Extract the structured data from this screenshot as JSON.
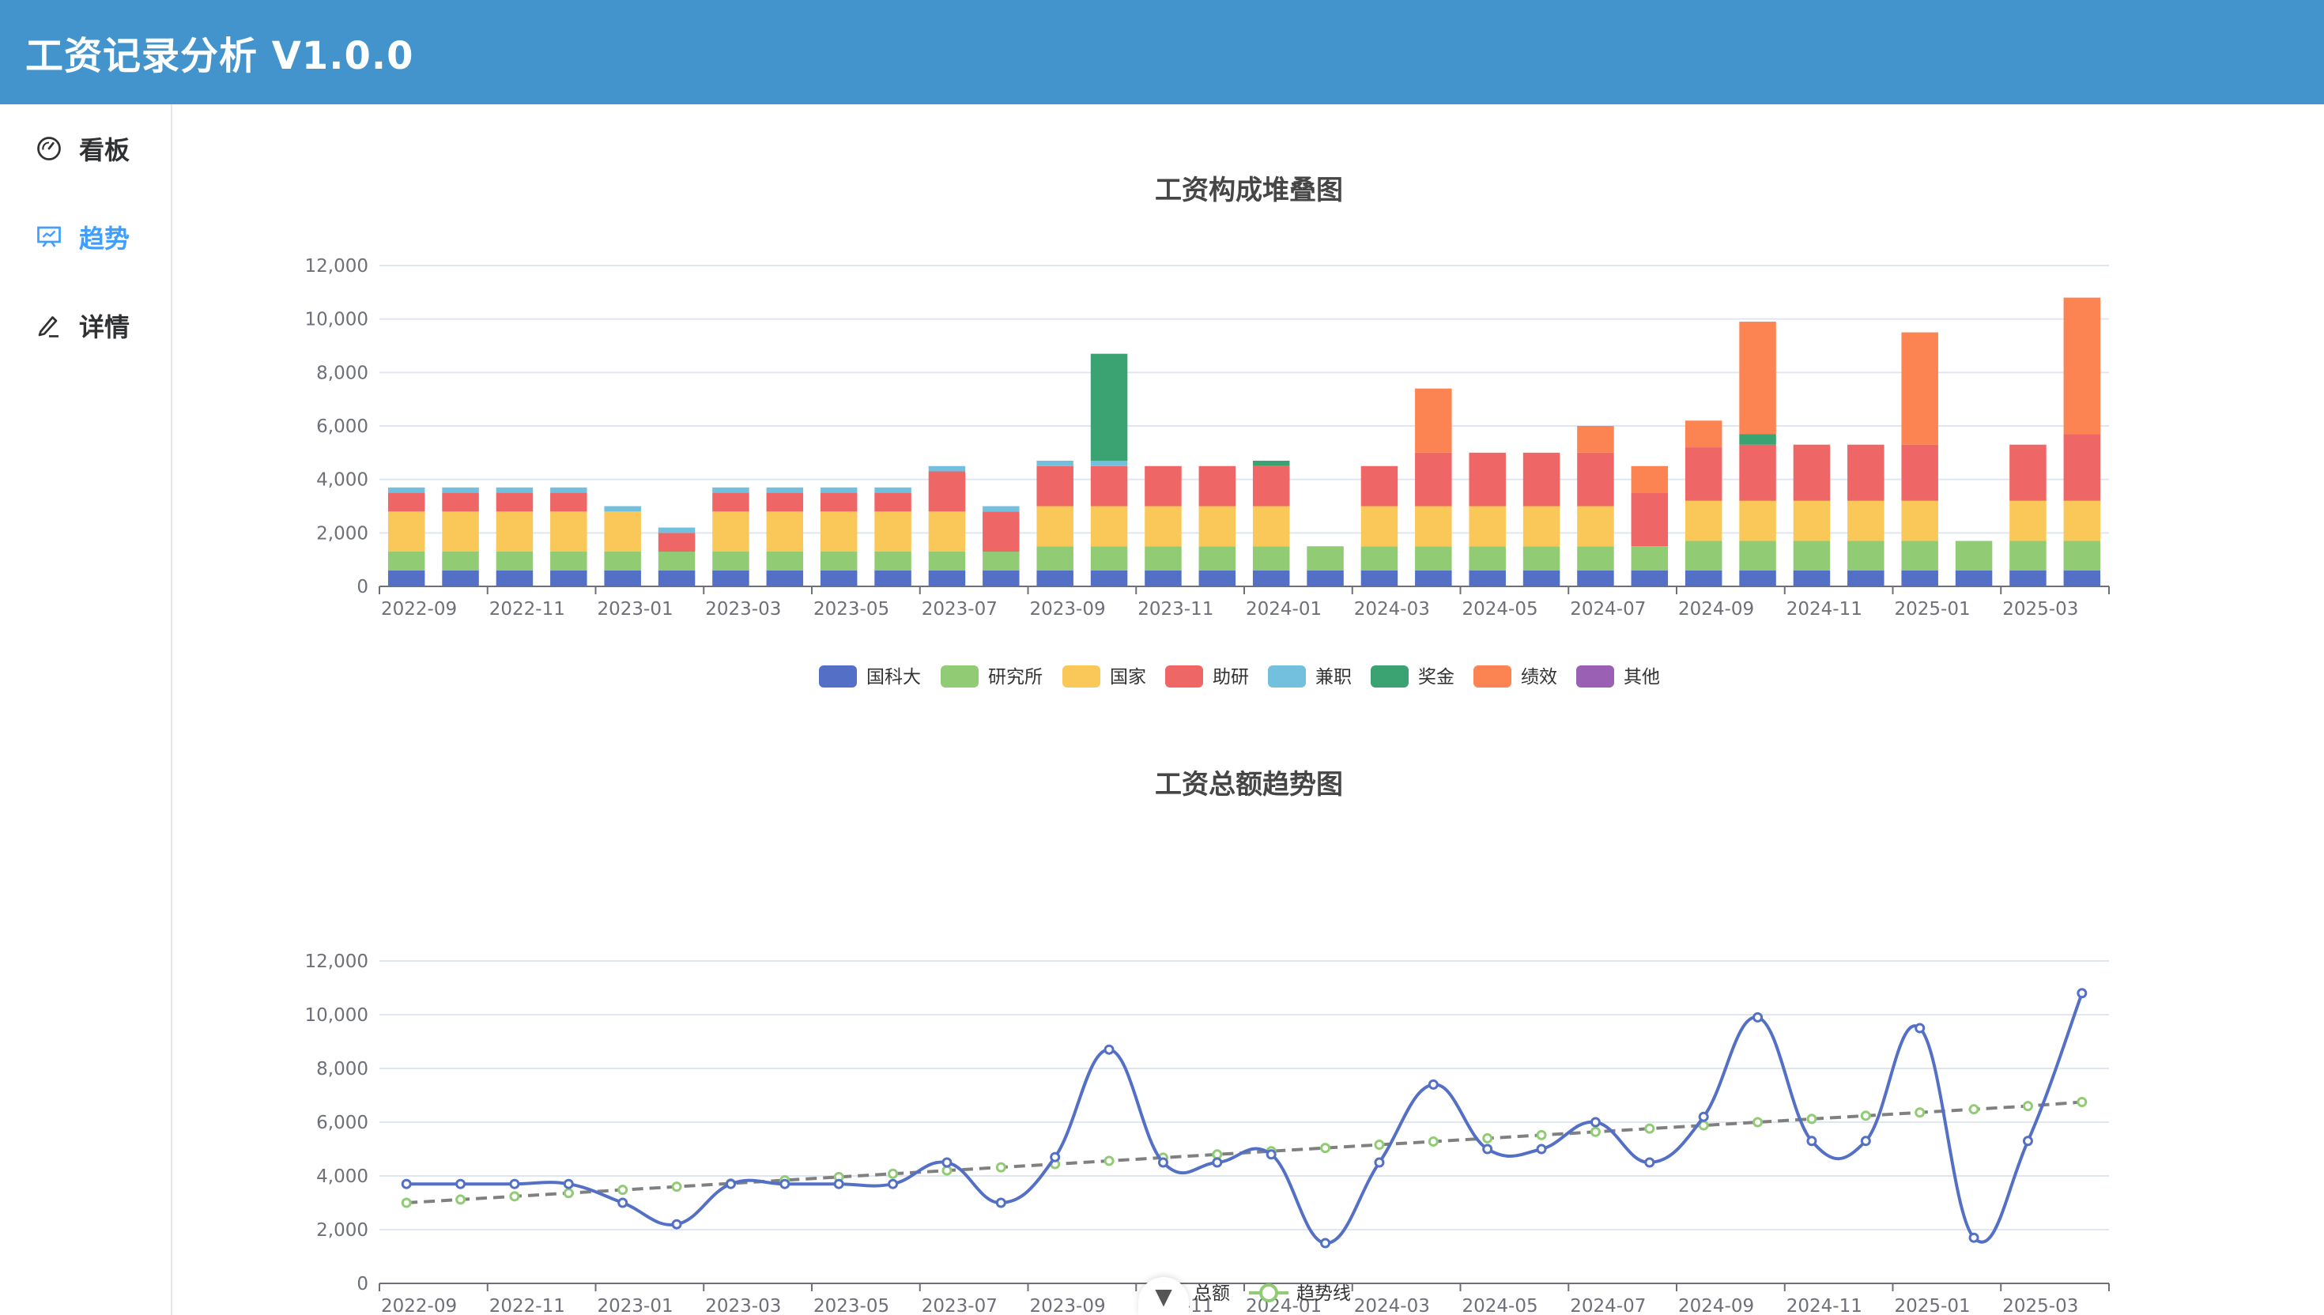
{
  "app": {
    "title": "工资记录分析 V1.0.0"
  },
  "sidebar": {
    "items": [
      {
        "label": "看板",
        "icon": "dashboard-icon",
        "active": false
      },
      {
        "label": "趋势",
        "icon": "presentation-icon",
        "active": true
      },
      {
        "label": "详情",
        "icon": "edit-icon",
        "active": false
      }
    ]
  },
  "colors": {
    "国科大": "#5470c6",
    "研究所": "#91cc75",
    "国家": "#fac858",
    "助研": "#ee6666",
    "兼职": "#73c0de",
    "奖金": "#3ba272",
    "绩效": "#fc8452",
    "其他": "#9a60b4",
    "总额": "#5470c6",
    "趋势线": "#91cc75"
  },
  "chart_data": [
    {
      "type": "bar",
      "stacked": true,
      "title": "工资构成堆叠图",
      "categories": [
        "2022-09",
        "2022-10",
        "2022-11",
        "2022-12",
        "2023-01",
        "2023-02",
        "2023-03",
        "2023-04",
        "2023-05",
        "2023-06",
        "2023-07",
        "2023-08",
        "2023-09",
        "2023-10",
        "2023-11",
        "2023-12",
        "2024-01",
        "2024-02",
        "2024-03",
        "2024-04",
        "2024-05",
        "2024-06",
        "2024-07",
        "2024-08",
        "2024-09",
        "2024-10",
        "2024-11",
        "2024-12",
        "2025-01",
        "2025-02",
        "2025-03",
        "2025-04"
      ],
      "x_tick_labels": [
        "2022-09",
        "2022-11",
        "2023-01",
        "2023-03",
        "2023-05",
        "2023-07",
        "2023-09",
        "2023-11",
        "2024-01",
        "2024-03",
        "2024-05",
        "2024-07",
        "2024-09",
        "2024-11",
        "2025-01",
        "2025-03"
      ],
      "ylim": [
        0,
        12000
      ],
      "y_ticks": [
        "0",
        "2,000",
        "4,000",
        "6,000",
        "8,000",
        "10,000",
        "12,000"
      ],
      "legend_position": "bottom",
      "series": [
        {
          "name": "国科大",
          "values": [
            600,
            600,
            600,
            600,
            600,
            600,
            600,
            600,
            600,
            600,
            600,
            600,
            600,
            600,
            600,
            600,
            600,
            600,
            600,
            600,
            600,
            600,
            600,
            600,
            600,
            600,
            600,
            600,
            600,
            600,
            600,
            600
          ]
        },
        {
          "name": "研究所",
          "values": [
            700,
            700,
            700,
            700,
            700,
            700,
            700,
            700,
            700,
            700,
            700,
            700,
            900,
            900,
            900,
            900,
            900,
            900,
            900,
            900,
            900,
            900,
            900,
            900,
            1100,
            1100,
            1100,
            1100,
            1100,
            1100,
            1100,
            1100
          ]
        },
        {
          "name": "国家",
          "values": [
            1500,
            1500,
            1500,
            1500,
            1500,
            0,
            1500,
            1500,
            1500,
            1500,
            1500,
            0,
            1500,
            1500,
            1500,
            1500,
            1500,
            0,
            1500,
            1500,
            1500,
            1500,
            1500,
            0,
            1500,
            1500,
            1500,
            1500,
            1500,
            0,
            1500,
            1500
          ]
        },
        {
          "name": "助研",
          "values": [
            700,
            700,
            700,
            700,
            0,
            700,
            700,
            700,
            700,
            700,
            1500,
            1500,
            1500,
            1500,
            1500,
            1500,
            1500,
            0,
            1500,
            2000,
            2000,
            2000,
            2000,
            2000,
            2000,
            2100,
            2100,
            2100,
            2100,
            0,
            2100,
            2500
          ]
        },
        {
          "name": "兼职",
          "values": [
            200,
            200,
            200,
            200,
            200,
            200,
            200,
            200,
            200,
            200,
            200,
            200,
            200,
            200,
            0,
            0,
            0,
            0,
            0,
            0,
            0,
            0,
            0,
            0,
            0,
            0,
            0,
            0,
            0,
            0,
            0,
            0
          ]
        },
        {
          "name": "奖金",
          "values": [
            0,
            0,
            0,
            0,
            0,
            0,
            0,
            0,
            0,
            0,
            0,
            0,
            0,
            4000,
            0,
            0,
            200,
            0,
            0,
            0,
            0,
            0,
            0,
            0,
            0,
            400,
            0,
            0,
            0,
            0,
            0,
            0
          ]
        },
        {
          "name": "绩效",
          "values": [
            0,
            0,
            0,
            0,
            0,
            0,
            0,
            0,
            0,
            0,
            0,
            0,
            0,
            0,
            0,
            0,
            0,
            0,
            0,
            2400,
            0,
            0,
            1000,
            1000,
            1000,
            4200,
            0,
            0,
            4200,
            0,
            0,
            5100
          ]
        },
        {
          "name": "其他",
          "values": [
            0,
            0,
            0,
            0,
            0,
            0,
            0,
            0,
            0,
            0,
            0,
            0,
            0,
            0,
            0,
            0,
            0,
            0,
            0,
            0,
            0,
            0,
            0,
            0,
            0,
            0,
            0,
            0,
            0,
            0,
            0,
            0
          ]
        }
      ]
    },
    {
      "type": "line",
      "title": "工资总额趋势图",
      "categories": [
        "2022-09",
        "2022-10",
        "2022-11",
        "2022-12",
        "2023-01",
        "2023-02",
        "2023-03",
        "2023-04",
        "2023-05",
        "2023-06",
        "2023-07",
        "2023-08",
        "2023-09",
        "2023-10",
        "2023-11",
        "2023-12",
        "2024-01",
        "2024-02",
        "2024-03",
        "2024-04",
        "2024-05",
        "2024-06",
        "2024-07",
        "2024-08",
        "2024-09",
        "2024-10",
        "2024-11",
        "2024-12",
        "2025-01",
        "2025-02",
        "2025-03",
        "2025-04"
      ],
      "x_tick_labels": [
        "2022-09",
        "2022-11",
        "2023-01",
        "2023-03",
        "2023-05",
        "2023-07",
        "2023-09",
        "2023-11",
        "2024-01",
        "2024-03",
        "2024-05",
        "2024-07",
        "2024-09",
        "2024-11",
        "2025-01",
        "2025-03"
      ],
      "ylim": [
        0,
        12000
      ],
      "y_ticks": [
        "0",
        "2,000",
        "4,000",
        "6,000",
        "8,000",
        "10,000",
        "12,000"
      ],
      "legend_position": "bottom",
      "series": [
        {
          "name": "总额",
          "smooth": true,
          "values": [
            3700,
            3700,
            3700,
            3700,
            3000,
            2200,
            3700,
            3700,
            3700,
            3700,
            4500,
            3000,
            4700,
            8700,
            4500,
            4500,
            4800,
            1500,
            4500,
            7400,
            5000,
            5000,
            6000,
            4500,
            6200,
            9900,
            5300,
            5300,
            9500,
            1700,
            5300,
            10800
          ]
        },
        {
          "name": "趋势线",
          "dashed": true,
          "values": [
            3000,
            3120,
            3240,
            3360,
            3480,
            3600,
            3720,
            3840,
            3960,
            4080,
            4200,
            4320,
            4440,
            4560,
            4680,
            4800,
            4920,
            5040,
            5160,
            5280,
            5400,
            5520,
            5640,
            5760,
            5880,
            6000,
            6120,
            6240,
            6360,
            6480,
            6600,
            6750
          ]
        }
      ]
    }
  ]
}
